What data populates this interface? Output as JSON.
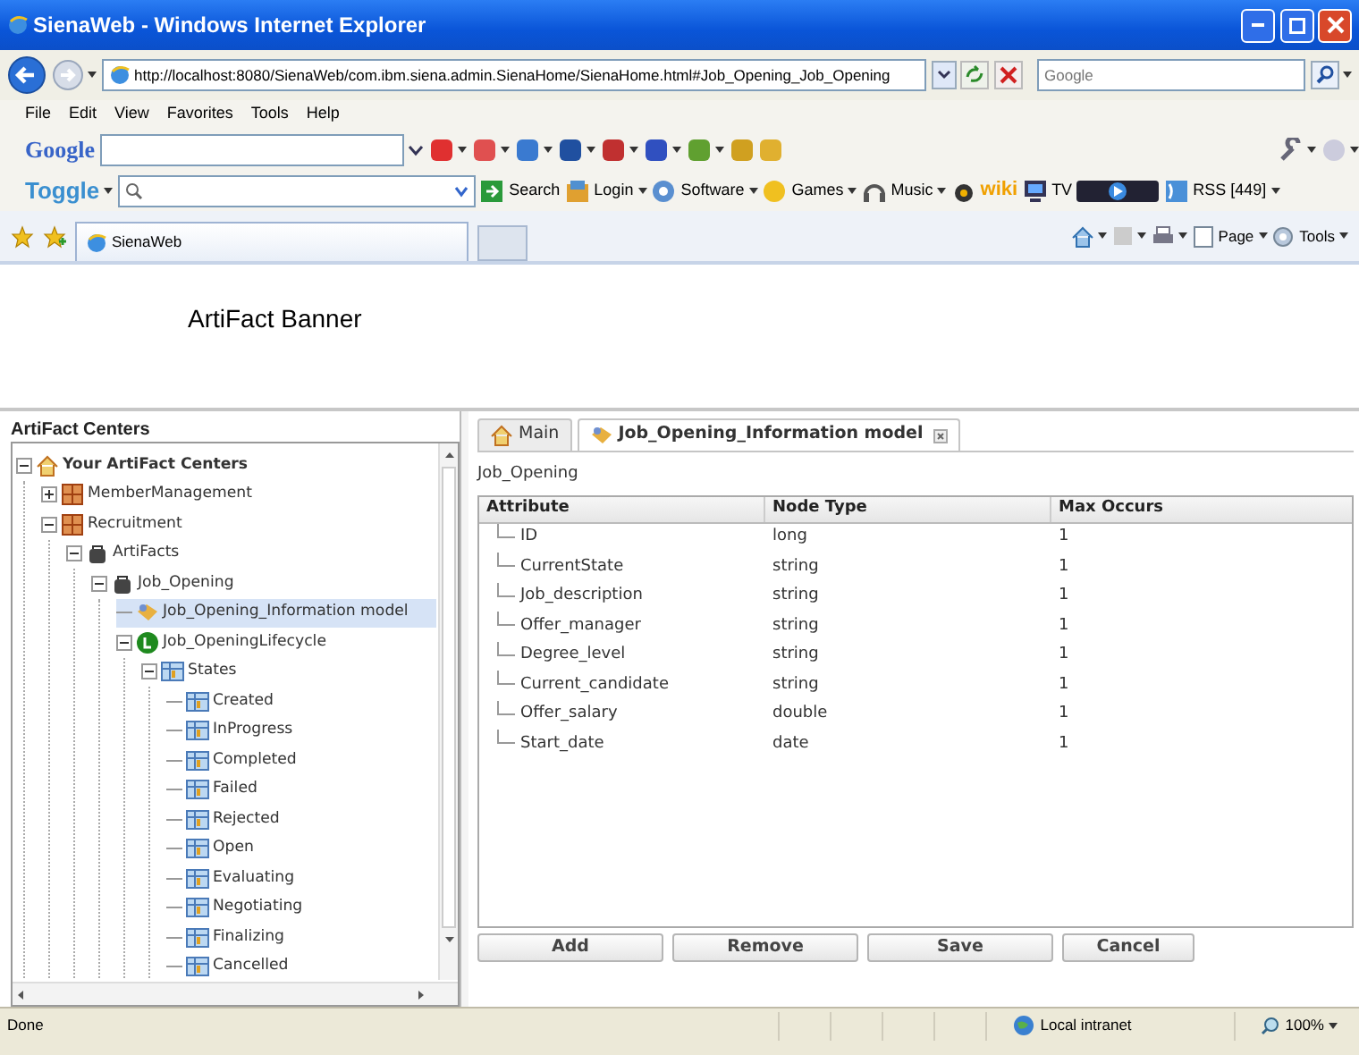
{
  "window": {
    "title": "SienaWeb - Windows Internet Explorer"
  },
  "address_bar": {
    "url": "http://localhost:8080/SienaWeb/com.ibm.siena.admin.SienaHome/SienaHome.html#Job_Opening_Job_Opening",
    "search_placeholder": "Google"
  },
  "menu": [
    "File",
    "Edit",
    "View",
    "Favorites",
    "Tools",
    "Help"
  ],
  "google_toolbar": {
    "logo": "Google"
  },
  "toggle_toolbar": {
    "logo": "Toggle",
    "items": [
      {
        "label": "Search"
      },
      {
        "label": "Login"
      },
      {
        "label": "Software"
      },
      {
        "label": "Games"
      },
      {
        "label": "Music"
      },
      {
        "label": "wiki"
      },
      {
        "label": "TV"
      },
      {
        "label": "RSS [449]"
      }
    ]
  },
  "browser_tabs": [
    {
      "label": "SienaWeb",
      "selected": true
    }
  ],
  "command_bar": [
    "Page",
    "Tools"
  ],
  "banner": {
    "title": "ArtiFact Banner"
  },
  "sidebar": {
    "title": "ArtiFact Centers",
    "tree": [
      {
        "label": "Your ArtiFact Centers",
        "kind": "home",
        "expanded": true,
        "selected": false,
        "children": [
          {
            "label": "MemberManagement",
            "kind": "package",
            "expanded": false,
            "selected": false
          },
          {
            "label": "Recruitment",
            "kind": "package",
            "expanded": true,
            "selected": false,
            "children": [
              {
                "label": "ArtiFacts",
                "kind": "artifact",
                "expanded": true,
                "selected": false,
                "children": [
                  {
                    "label": "Job_Opening",
                    "kind": "artifact",
                    "expanded": true,
                    "selected": false,
                    "children": [
                      {
                        "label": "Job_Opening_Information model",
                        "kind": "model",
                        "selected": true
                      },
                      {
                        "label": "Job_OpeningLifecycle",
                        "kind": "lifecycle",
                        "expanded": true,
                        "selected": false,
                        "children": [
                          {
                            "label": "States",
                            "kind": "state",
                            "expanded": true,
                            "selected": false,
                            "children": [
                              {
                                "label": "Created",
                                "kind": "state",
                                "selected": false
                              },
                              {
                                "label": "InProgress",
                                "kind": "state",
                                "selected": false
                              },
                              {
                                "label": "Completed",
                                "kind": "state",
                                "selected": false
                              },
                              {
                                "label": "Failed",
                                "kind": "state",
                                "selected": false
                              },
                              {
                                "label": "Rejected",
                                "kind": "state",
                                "selected": false
                              },
                              {
                                "label": "Open",
                                "kind": "state",
                                "selected": false
                              },
                              {
                                "label": "Evaluating",
                                "kind": "state",
                                "selected": false
                              },
                              {
                                "label": "Negotiating",
                                "kind": "state",
                                "selected": false
                              },
                              {
                                "label": "Finalizing",
                                "kind": "state",
                                "selected": false
                              },
                              {
                                "label": "Cancelled",
                                "kind": "state",
                                "selected": false
                              }
                            ]
                          }
                        ]
                      }
                    ]
                  }
                ]
              }
            ]
          }
        ]
      }
    ]
  },
  "content_tabs": [
    {
      "label": "Main",
      "kind": "home",
      "selected": false,
      "closable": false
    },
    {
      "label": "Job_Opening_Information model",
      "kind": "model",
      "selected": true,
      "closable": true
    }
  ],
  "breadcrumb": "Job_Opening",
  "table": {
    "columns": [
      "Attribute",
      "Node Type",
      "Max Occurs"
    ],
    "rows": [
      [
        "ID",
        "long",
        "1"
      ],
      [
        "CurrentState",
        "string",
        "1"
      ],
      [
        "Job_description",
        "string",
        "1"
      ],
      [
        "Offer_manager",
        "string",
        "1"
      ],
      [
        "Degree_level",
        "string",
        "1"
      ],
      [
        "Current_candidate",
        "string",
        "1"
      ],
      [
        "Offer_salary",
        "double",
        "1"
      ],
      [
        "Start_date",
        "date",
        "1"
      ]
    ]
  },
  "buttons": [
    "Add",
    "Remove",
    "Save",
    "Cancel"
  ],
  "status_bar": {
    "text": "Done",
    "zone": "Local intranet",
    "zoom": "100%"
  }
}
